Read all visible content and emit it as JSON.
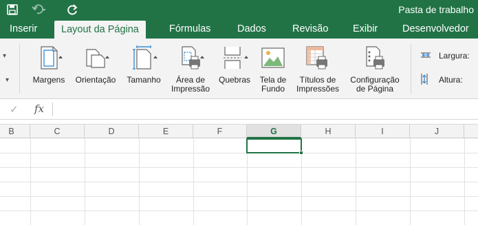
{
  "titlebar": {
    "document_title": "Pasta de trabalho",
    "quick_access": [
      "save-icon",
      "undo-icon",
      "redo-icon"
    ]
  },
  "tabs": [
    {
      "label": "Inserir"
    },
    {
      "label": "Layout da Página",
      "active": true
    },
    {
      "label": "Fórmulas"
    },
    {
      "label": "Dados"
    },
    {
      "label": "Revisão"
    },
    {
      "label": "Exibir"
    },
    {
      "label": "Desenvolvedor"
    }
  ],
  "ribbon": {
    "margins": "Margens",
    "orientation": "Orientação",
    "size": "Tamanho",
    "print_area_1": "Área de",
    "print_area_2": "Impressão",
    "breaks": "Quebras",
    "background_1": "Tela de",
    "background_2": "Fundo",
    "print_titles_1": "Títulos de",
    "print_titles_2": "Impressões",
    "page_setup_1": "Configuração",
    "page_setup_2": "de Página",
    "width_label": "Largura:",
    "height_label": "Altura:"
  },
  "formula_bar": {
    "fx": "fx",
    "value": ""
  },
  "columns": [
    "B",
    "C",
    "D",
    "E",
    "F",
    "G",
    "H",
    "I",
    "J"
  ],
  "selected_column": "G",
  "colors": {
    "accent": "#217346",
    "ribbon_bg": "#f3f3f3",
    "gridline": "#e1e1e1"
  }
}
